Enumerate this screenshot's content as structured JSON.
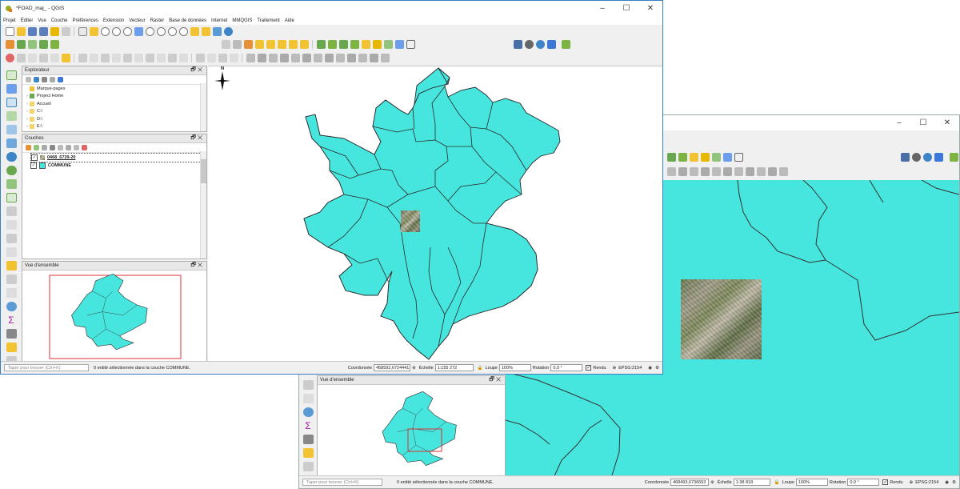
{
  "main_window": {
    "title": "*FOAD_maj_ - QGIS",
    "controls": {
      "minimize": "–",
      "maximize": "☐",
      "close": "✕"
    },
    "menu": [
      "Projet",
      "Éditer",
      "Vue",
      "Couche",
      "Préférences",
      "Extension",
      "Vecteur",
      "Raster",
      "Base de données",
      "Internet",
      "MMQGIS",
      "Traitement",
      "Aide"
    ],
    "explorer": {
      "title": "Explorateur",
      "items": [
        {
          "label": "Marque-pages",
          "icon": "star-icon"
        },
        {
          "label": "Project Home",
          "icon": "project-home-icon"
        },
        {
          "label": "Accueil",
          "icon": "folder-icon"
        },
        {
          "label": "C:\\",
          "icon": "folder-icon"
        },
        {
          "label": "D:\\",
          "icon": "folder-icon"
        },
        {
          "label": "E:\\",
          "icon": "folder-icon"
        }
      ]
    },
    "layers": {
      "title": "Couches",
      "items": [
        {
          "label": "0468_6739-20",
          "checked": true,
          "icon": "raster-layer-icon"
        },
        {
          "label": "COMMUNE",
          "checked": true,
          "icon": "polygon-layer-icon"
        }
      ]
    },
    "overview": {
      "title": "Vue d'ensemble"
    },
    "north_arrow": "N",
    "status": {
      "locator_placeholder": "Taper pour trouver (Ctrl+K)",
      "message": "0 entité sélectionnée dans la couche COMMUNE.",
      "coord_label": "Coordonnée",
      "coord_value": "458592,6724441",
      "scale_label": "Échelle",
      "scale_value": "1:155 272",
      "magnifier_label": "Loupe",
      "magnifier_value": "100%",
      "rotation_label": "Rotation",
      "rotation_value": "0,0 °",
      "render_label": "Rendu",
      "crs": "EPSG:2154"
    }
  },
  "second_window": {
    "controls": {
      "minimize": "–",
      "maximize": "☐",
      "close": "✕"
    },
    "overview": {
      "title": "Vue d'ensemble"
    },
    "status": {
      "locator_placeholder": "Taper pour trouver (Ctrl+K)",
      "message": "0 entité sélectionnée dans la couche COMMUNE.",
      "coord_label": "Coordonnée",
      "coord_value": "468493,6736653",
      "scale_label": "Échelle",
      "scale_value": "1:38 818",
      "magnifier_label": "Loupe",
      "magnifier_value": "100%",
      "rotation_label": "Rotation",
      "rotation_value": "0,0 °",
      "render_label": "Rendu",
      "crs": "EPSG:2154"
    }
  },
  "colors": {
    "commune_fill": "#46e6de",
    "commune_stroke": "#2a2a2a",
    "extent_frame": "#e03030",
    "title_accent": "#3a7ebf"
  }
}
